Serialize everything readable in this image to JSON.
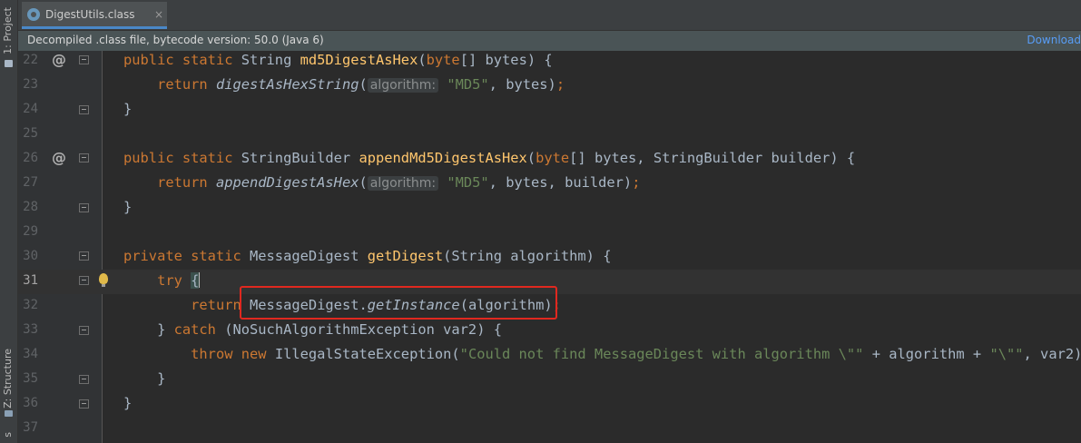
{
  "toolwindows": {
    "project_label": "1: Project",
    "structure_label": "Z: Structure",
    "extra_label": "s"
  },
  "tab": {
    "label": "DigestUtils.class",
    "close": "×"
  },
  "banner": {
    "text": "Decompiled .class file, bytecode version: 50.0 (Java 6)",
    "link": "Download"
  },
  "editor": {
    "current_line": "31",
    "highlighted_line": "32",
    "colors": {
      "keyword": "#cc7832",
      "function": "#ffc66d",
      "string": "#6a8759",
      "text": "#a9b7c6",
      "highlight_box": "#e0281f"
    },
    "lines": [
      {
        "num": "22",
        "override": true,
        "fold": "open",
        "seg": [
          [
            "kw",
            "public static "
          ],
          [
            "",
            "String "
          ],
          [
            "fn",
            "md5DigestAsHex"
          ],
          [
            "",
            "("
          ],
          [
            "kw",
            "byte"
          ],
          [
            "",
            "[] bytes) {"
          ]
        ]
      },
      {
        "num": "23",
        "seg": [
          [
            "",
            "    "
          ],
          [
            "kw",
            "return "
          ],
          [
            "it",
            "digestAsHexString"
          ],
          [
            "",
            "("
          ],
          [
            "hint",
            "algorithm:"
          ],
          [
            "str",
            " \"MD5\""
          ],
          [
            "",
            ", bytes)"
          ],
          [
            "kw",
            ";"
          ]
        ]
      },
      {
        "num": "24",
        "fold": "close",
        "seg": [
          [
            "",
            "}"
          ]
        ]
      },
      {
        "num": "25",
        "seg": []
      },
      {
        "num": "26",
        "override": true,
        "fold": "open",
        "seg": [
          [
            "kw",
            "public static "
          ],
          [
            "",
            "StringBuilder "
          ],
          [
            "fn",
            "appendMd5DigestAsHex"
          ],
          [
            "",
            "("
          ],
          [
            "kw",
            "byte"
          ],
          [
            "",
            "[] bytes, StringBuilder builder) {"
          ]
        ]
      },
      {
        "num": "27",
        "seg": [
          [
            "",
            "    "
          ],
          [
            "kw",
            "return "
          ],
          [
            "it",
            "appendDigestAsHex"
          ],
          [
            "",
            "("
          ],
          [
            "hint",
            "algorithm:"
          ],
          [
            "str",
            " \"MD5\""
          ],
          [
            "",
            ", bytes, builder)"
          ],
          [
            "kw",
            ";"
          ]
        ]
      },
      {
        "num": "28",
        "fold": "close",
        "seg": [
          [
            "",
            "}"
          ]
        ]
      },
      {
        "num": "29",
        "seg": []
      },
      {
        "num": "30",
        "fold": "open",
        "seg": [
          [
            "kw",
            "private static "
          ],
          [
            "",
            "MessageDigest "
          ],
          [
            "fn",
            "getDigest"
          ],
          [
            "",
            "(String algorithm) {"
          ]
        ]
      },
      {
        "num": "31",
        "fold": "open",
        "bulb": true,
        "seg": [
          [
            "",
            "    "
          ],
          [
            "kw",
            "try "
          ],
          [
            "brace",
            "{"
          ],
          [
            "caret",
            ""
          ]
        ]
      },
      {
        "num": "32",
        "seg": [
          [
            "",
            "        "
          ],
          [
            "kw",
            "return "
          ],
          [
            "",
            "MessageDigest."
          ],
          [
            "it",
            "getInstance"
          ],
          [
            "",
            "(algorithm)"
          ],
          [
            "kw",
            ";"
          ]
        ]
      },
      {
        "num": "33",
        "fold": "close",
        "seg": [
          [
            "",
            "    } "
          ],
          [
            "kw",
            "catch "
          ],
          [
            "",
            "(NoSuchAlgorithmException var2) {"
          ]
        ]
      },
      {
        "num": "34",
        "seg": [
          [
            "",
            "        "
          ],
          [
            "kw",
            "throw new "
          ],
          [
            "",
            "IllegalStateException("
          ],
          [
            "str",
            "\"Could not find MessageDigest with algorithm \\\"\""
          ],
          [
            "",
            " + algorithm + "
          ],
          [
            "str",
            "\"\\\"\""
          ],
          [
            "",
            ", var2)"
          ],
          [
            "kw",
            ";"
          ]
        ]
      },
      {
        "num": "35",
        "fold": "close",
        "seg": [
          [
            "",
            "    }"
          ]
        ]
      },
      {
        "num": "36",
        "fold": "close",
        "seg": [
          [
            "",
            "}"
          ]
        ]
      },
      {
        "num": "37",
        "seg": []
      }
    ]
  }
}
